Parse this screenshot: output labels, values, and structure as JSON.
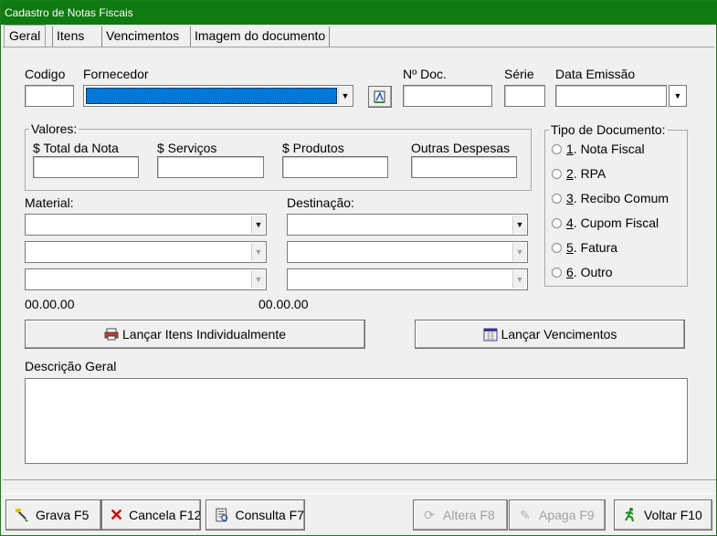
{
  "window": {
    "title": "Cadastro de Notas Fiscais"
  },
  "tabs": [
    "Geral",
    "Itens",
    "Vencimentos",
    "Imagem do documento"
  ],
  "header_fields": {
    "codigo": "Codigo",
    "fornecedor": "Fornecedor",
    "num_doc": "Nº Doc.",
    "serie": "Série",
    "data_emissao": "Data Emissão"
  },
  "valores": {
    "title": "Valores:",
    "total": "$ Total da Nota",
    "servicos": "$ Serviços",
    "produtos": "$ Produtos",
    "outras": "Outras Despesas"
  },
  "tipo_documento": {
    "title": "Tipo de Documento:",
    "options": [
      {
        "key": "1",
        "label": ". Nota Fiscal"
      },
      {
        "key": "2",
        "label": ". RPA"
      },
      {
        "key": "3",
        "label": ". Recibo Comum"
      },
      {
        "key": "4",
        "label": ". Cupom Fiscal"
      },
      {
        "key": "5",
        "label": ". Fatura"
      },
      {
        "key": "6",
        "label": ". Outro"
      }
    ]
  },
  "material": {
    "label": "Material:",
    "total": "00.00.00"
  },
  "destinacao": {
    "label": "Destinação:",
    "total": "00.00.00"
  },
  "buttons": {
    "lancar_itens": "Lançar Itens Individualmente",
    "lancar_vencimentos": "Lançar Vencimentos"
  },
  "descricao": {
    "label": "Descrição Geral"
  },
  "toolbar": {
    "grava": "Grava F5",
    "cancela": "Cancela F12",
    "consulta": "Consulta F7",
    "altera": "Altera F8",
    "apaga": "Apaga F9",
    "voltar": "Voltar F10"
  },
  "colors": {
    "titlebar": "#0f7a0f",
    "selection": "#0078d7"
  }
}
